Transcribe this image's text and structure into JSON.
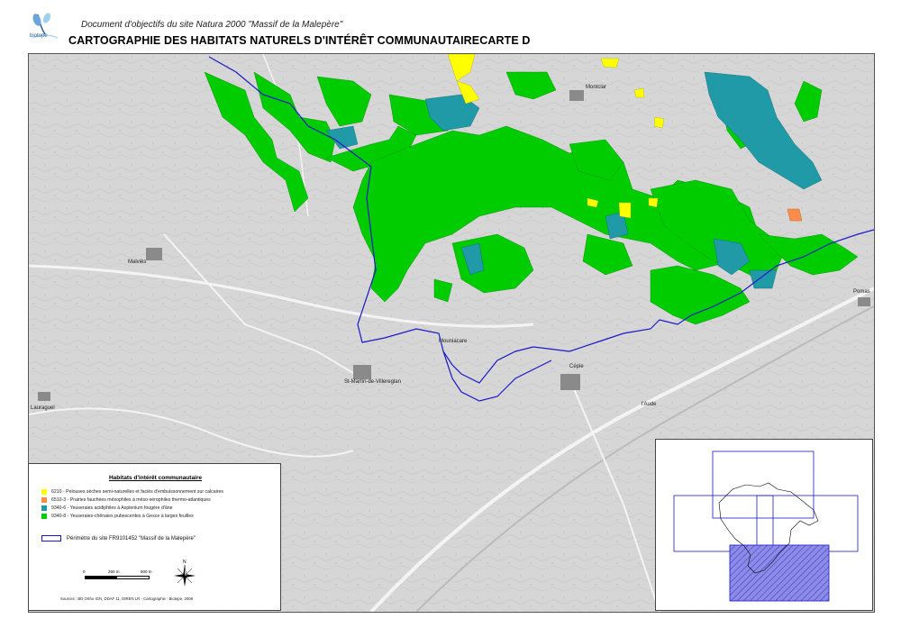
{
  "header": {
    "logo_text": "biotope",
    "subtitle": "Document d'objectifs du site Natura 2000 \"Massif de la Malepère\"",
    "title": "CARTOGRAPHIE DES HABITATS NATURELS D'INTÉRÊT COMMUNAUTAIRECARTE D"
  },
  "map": {
    "place_labels": [
      "Montclar",
      "Malviès",
      "St-Martin-de-Villereglan",
      "Lauraguel",
      "Cépie",
      "Pomas",
      "Mouniacare",
      "l'Aude"
    ]
  },
  "legend": {
    "title": "Habitats d'intérêt communautaire",
    "items": [
      {
        "code": "6210",
        "label": "6210 - Pelouses sèches semi-naturelles et faciès d'embuissonnement sur calcaires",
        "color": "#ffff00"
      },
      {
        "code": "6510-3",
        "label": "6510-3 - Prairies fauchées mésophiles à méso-xérophiles thermo-atlantiques",
        "color": "#ff8c4a"
      },
      {
        "code": "9340-6",
        "label": "9340-6 - Yeuseraies acidiphiles à Asplenium fougère d'âne",
        "color": "#1f9aa6"
      },
      {
        "code": "9340-8",
        "label": "9340-8 - Yeuseraies-chênaies pubescentes à Gesce à larges feuilles",
        "color": "#00cc00"
      }
    ],
    "perimeter_label": "Périmètre du site FR9101452 \"Massif de la Malepère\"",
    "perimeter_color": "#1a1ac8",
    "scale": {
      "zero": "0",
      "mid": "250 m",
      "end": "500 m"
    },
    "north_label": "N",
    "sources": "Sources : BD Ortho IGN, DDAF 11, DIREN LR - Cartographie : Biotope, 2008"
  },
  "colors": {
    "background_map": "#d9d9d9",
    "habitat_green": "#00cc00",
    "habitat_teal": "#1f9aa6",
    "habitat_yellow": "#ffff00",
    "habitat_orange": "#ff8c4a",
    "perimeter": "#1a1ac8",
    "inset_fill": "#8c8ce8"
  }
}
